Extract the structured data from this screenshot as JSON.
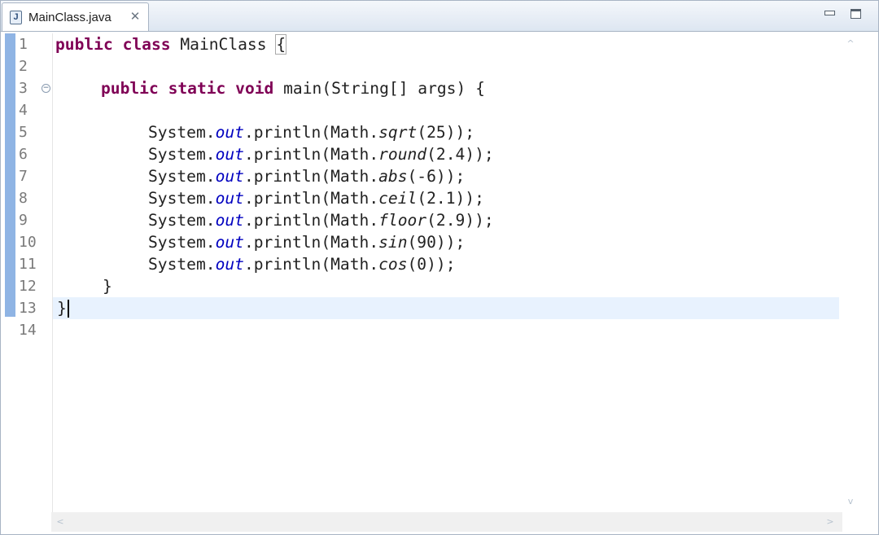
{
  "editor": {
    "tab": {
      "label": "MainClass.java",
      "icon_letter": "J",
      "close_glyph": "✕"
    },
    "window_controls": {
      "minimize": "minimize",
      "maximize": "maximize"
    },
    "gutter": {
      "line_numbers": [
        "1",
        "2",
        "3",
        "4",
        "5",
        "6",
        "7",
        "8",
        "9",
        "10",
        "11",
        "12",
        "13",
        "14"
      ],
      "fold_marker_line": "3",
      "fold_glyph": "−"
    },
    "code": {
      "l1_kw1": "public",
      "l1_kw2": "class",
      "l1_name": "MainClass",
      "l1_brace": "{",
      "l3_kw1": "public",
      "l3_kw2": "static",
      "l3_kw3": "void",
      "l3_rest": "main(String[] args) {",
      "calls": [
        {
          "prefix": "System.",
          "field": "out",
          "mid": ".println(Math.",
          "method": "sqrt",
          "suffix": "(25));"
        },
        {
          "prefix": "System.",
          "field": "out",
          "mid": ".println(Math.",
          "method": "round",
          "suffix": "(2.4));"
        },
        {
          "prefix": "System.",
          "field": "out",
          "mid": ".println(Math.",
          "method": "abs",
          "suffix": "(-6));"
        },
        {
          "prefix": "System.",
          "field": "out",
          "mid": ".println(Math.",
          "method": "ceil",
          "suffix": "(2.1));"
        },
        {
          "prefix": "System.",
          "field": "out",
          "mid": ".println(Math.",
          "method": "floor",
          "suffix": "(2.9));"
        },
        {
          "prefix": "System.",
          "field": "out",
          "mid": ".println(Math.",
          "method": "sin",
          "suffix": "(90));"
        },
        {
          "prefix": "System.",
          "field": "out",
          "mid": ".println(Math.",
          "method": "cos",
          "suffix": "(0));"
        }
      ],
      "l12": "}",
      "l13": "}"
    },
    "scroll": {
      "up": "^",
      "down": "v",
      "left": "<",
      "right": ">"
    },
    "colors": {
      "keyword": "#7f0055",
      "field": "#0000c0",
      "current_line": "#e8f2fe",
      "ruler": "#8fb4e4"
    }
  }
}
